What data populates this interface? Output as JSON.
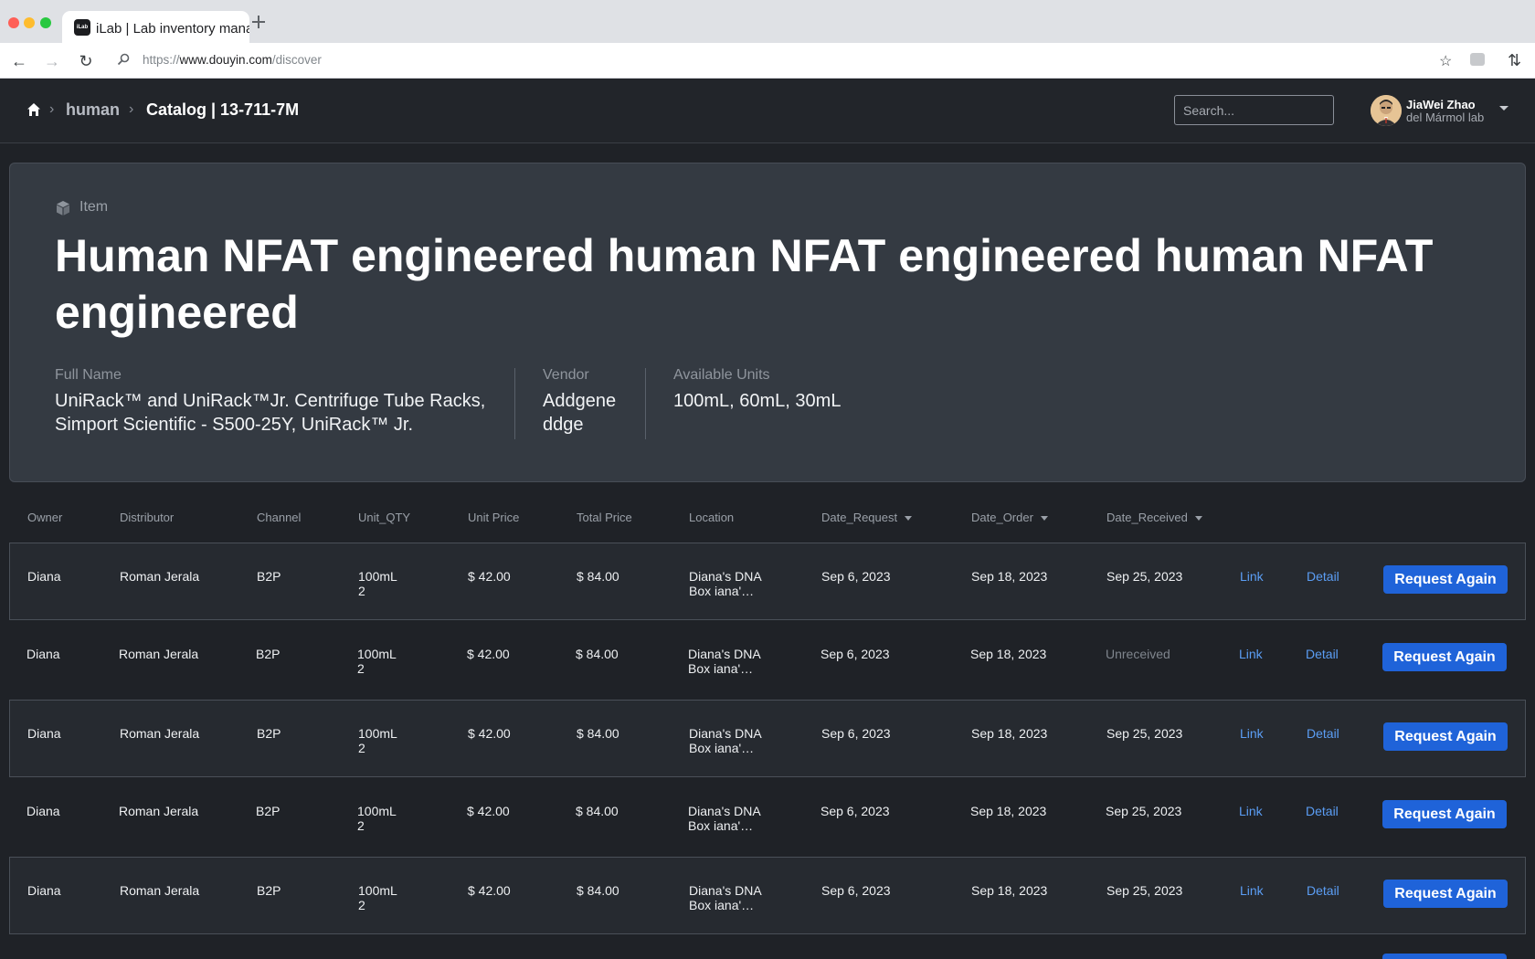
{
  "browser": {
    "tab_title": "iLab | Lab inventory mana",
    "favicon_text": "iLab",
    "url_prefix": "https://",
    "url_host": "www.douyin.com",
    "url_path": "/discover"
  },
  "header": {
    "breadcrumb": [
      "human",
      "Catalog | 13-711-7M"
    ],
    "search_placeholder": "Search...",
    "user_name": "JiaWei Zhao",
    "user_lab": "del Mármol lab"
  },
  "item": {
    "kind": "Item",
    "title": "Human NFAT engineered human NFAT engineered human NFAT engineered",
    "full_name_label": "Full Name",
    "full_name": "UniRack™ and UniRack™Jr. Centrifuge Tube Racks, Simport Scientific - S500-25Y, UniRack™ Jr.",
    "vendor_label": "Vendor",
    "vendor_line1": "Addgene",
    "vendor_line2": "ddge",
    "units_label": "Available Units",
    "units": "100mL, 60mL, 30mL"
  },
  "table": {
    "headers": [
      "Owner",
      "Distributor",
      "Channel",
      "Unit_QTY",
      "Unit Price",
      "Total Price",
      "Location",
      "Date_Request",
      "Date_Order",
      "Date_Received"
    ],
    "rows": [
      {
        "owner": "Diana",
        "distributor": "Roman Jerala",
        "channel": "B2P",
        "unit": "100mL",
        "qty": "2",
        "unit_price": "$ 42.00",
        "total_price": "$ 84.00",
        "loc1": "Diana's DNA",
        "loc2": "Box iana'…",
        "date_request": "Sep 6, 2023",
        "date_order": "Sep 18, 2023",
        "date_received": "Sep 25, 2023",
        "link": "Link",
        "detail": "Detail",
        "action": "Request Again"
      },
      {
        "owner": "Diana",
        "distributor": "Roman Jerala",
        "channel": "B2P",
        "unit": "100mL",
        "qty": "2",
        "unit_price": "$ 42.00",
        "total_price": "$ 84.00",
        "loc1": "Diana's DNA",
        "loc2": "Box iana'…",
        "date_request": "Sep 6, 2023",
        "date_order": "Sep 18, 2023",
        "date_received": "Unreceived",
        "link": "Link",
        "detail": "Detail",
        "action": "Request Again"
      },
      {
        "owner": "Diana",
        "distributor": "Roman Jerala",
        "channel": "B2P",
        "unit": "100mL",
        "qty": "2",
        "unit_price": "$ 42.00",
        "total_price": "$ 84.00",
        "loc1": "Diana's DNA",
        "loc2": "Box iana'…",
        "date_request": "Sep 6, 2023",
        "date_order": "Sep 18, 2023",
        "date_received": "Sep 25, 2023",
        "link": "Link",
        "detail": "Detail",
        "action": "Request Again"
      },
      {
        "owner": "Diana",
        "distributor": "Roman Jerala",
        "channel": "B2P",
        "unit": "100mL",
        "qty": "2",
        "unit_price": "$ 42.00",
        "total_price": "$ 84.00",
        "loc1": "Diana's DNA",
        "loc2": "Box iana'…",
        "date_request": "Sep 6, 2023",
        "date_order": "Sep 18, 2023",
        "date_received": "Sep 25, 2023",
        "link": "Link",
        "detail": "Detail",
        "action": "Request Again"
      },
      {
        "owner": "Diana",
        "distributor": "Roman Jerala",
        "channel": "B2P",
        "unit": "100mL",
        "qty": "2",
        "unit_price": "$ 42.00",
        "total_price": "$ 84.00",
        "loc1": "Diana's DNA",
        "loc2": "Box iana'…",
        "date_request": "Sep 6, 2023",
        "date_order": "Sep 18, 2023",
        "date_received": "Sep 25, 2023",
        "link": "Link",
        "detail": "Detail",
        "action": "Request Again"
      }
    ]
  },
  "colors": {
    "background": "#1f2227",
    "card": "#343a42",
    "accent_button": "#1f63d9",
    "link": "#5b9ef5"
  }
}
